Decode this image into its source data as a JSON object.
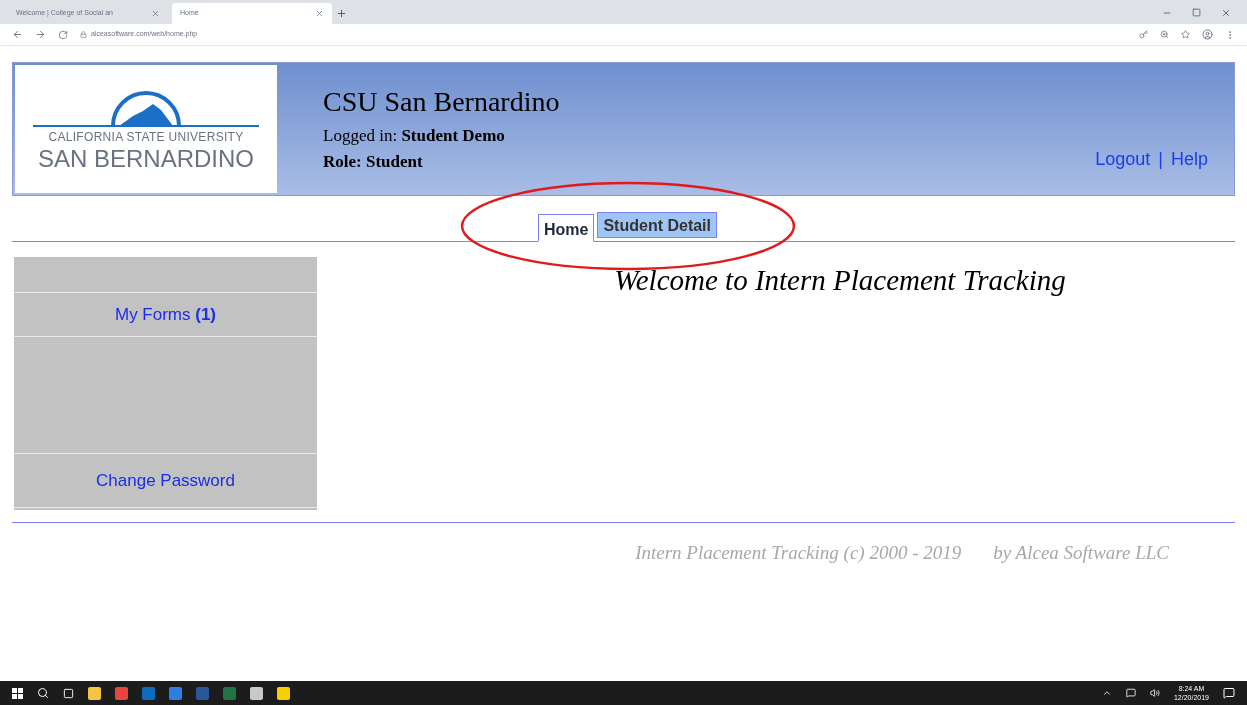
{
  "browser": {
    "tabs": [
      {
        "title": "Welcome | College of Social an",
        "selected": false
      },
      {
        "title": "Home",
        "selected": true
      }
    ],
    "url": "alceasoftware.com/web/home.php"
  },
  "logo": {
    "line1": "CALIFORNIA STATE UNIVERSITY",
    "line2": "SAN BERNARDINO"
  },
  "header": {
    "title": "CSU San Bernardino",
    "logged_in_label": "Logged in:",
    "logged_in_user": "Student Demo",
    "role": "Role: Student",
    "links": [
      "Logout",
      "Help"
    ],
    "separator": "|"
  },
  "nav_tabs": [
    {
      "label": "Home",
      "selected": true
    },
    {
      "label": "Student Detail",
      "selected": false
    }
  ],
  "sidebar": {
    "items": [
      {
        "label": "My Forms",
        "count": "(1)"
      },
      {
        "label": "Change Password"
      }
    ]
  },
  "welcome": "Welcome to Intern Placement Tracking",
  "footer": {
    "copyright": "Intern Placement Tracking (c) 2000 - 2019",
    "vendor": "by Alcea Software LLC"
  },
  "taskbar": {
    "time": "8:24 AM",
    "date": "12/20/2019"
  }
}
